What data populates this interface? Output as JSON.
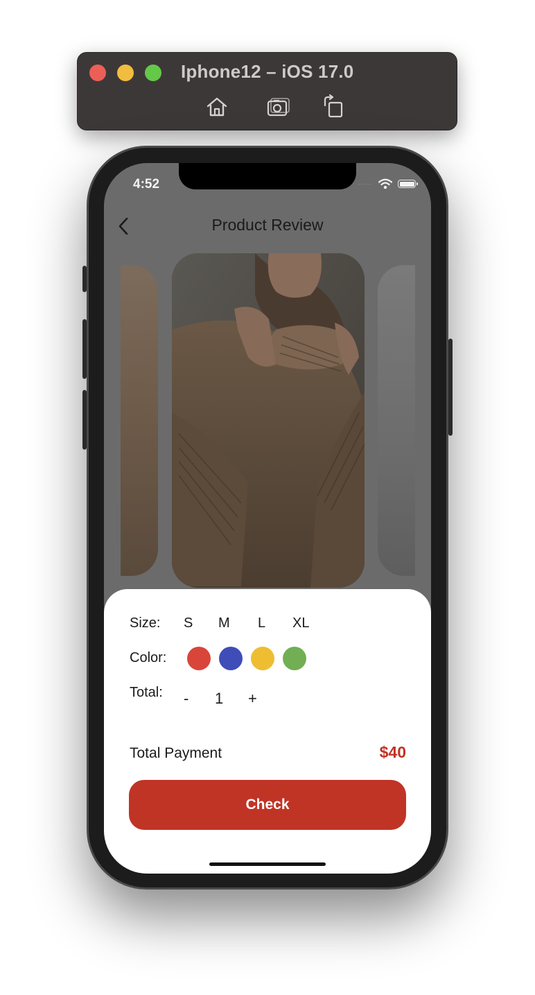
{
  "simulator": {
    "title": "Iphone12 – iOS 17.0",
    "tools": [
      "home-icon",
      "screenshot-icon",
      "rotate-icon"
    ]
  },
  "status_bar": {
    "time": "4:52",
    "signal": "·····"
  },
  "nav": {
    "title": "Product Review",
    "back_icon": "chevron-left-icon"
  },
  "product": {
    "options": {
      "size_label": "Size:",
      "sizes": [
        "S",
        "M",
        "L",
        "XL"
      ],
      "color_label": "Color:",
      "colors": [
        "#d94539",
        "#3f4db8",
        "#efbd32",
        "#72ae53"
      ],
      "total_label": "Total:",
      "decrement": "-",
      "quantity": "1",
      "increment": "+"
    },
    "payment": {
      "label": "Total Payment",
      "amount": "$40"
    },
    "check_button": "Check"
  },
  "colors": {
    "accent": "#c03426",
    "overlay": "#6b6b6b",
    "sheet": "#ffffff"
  }
}
